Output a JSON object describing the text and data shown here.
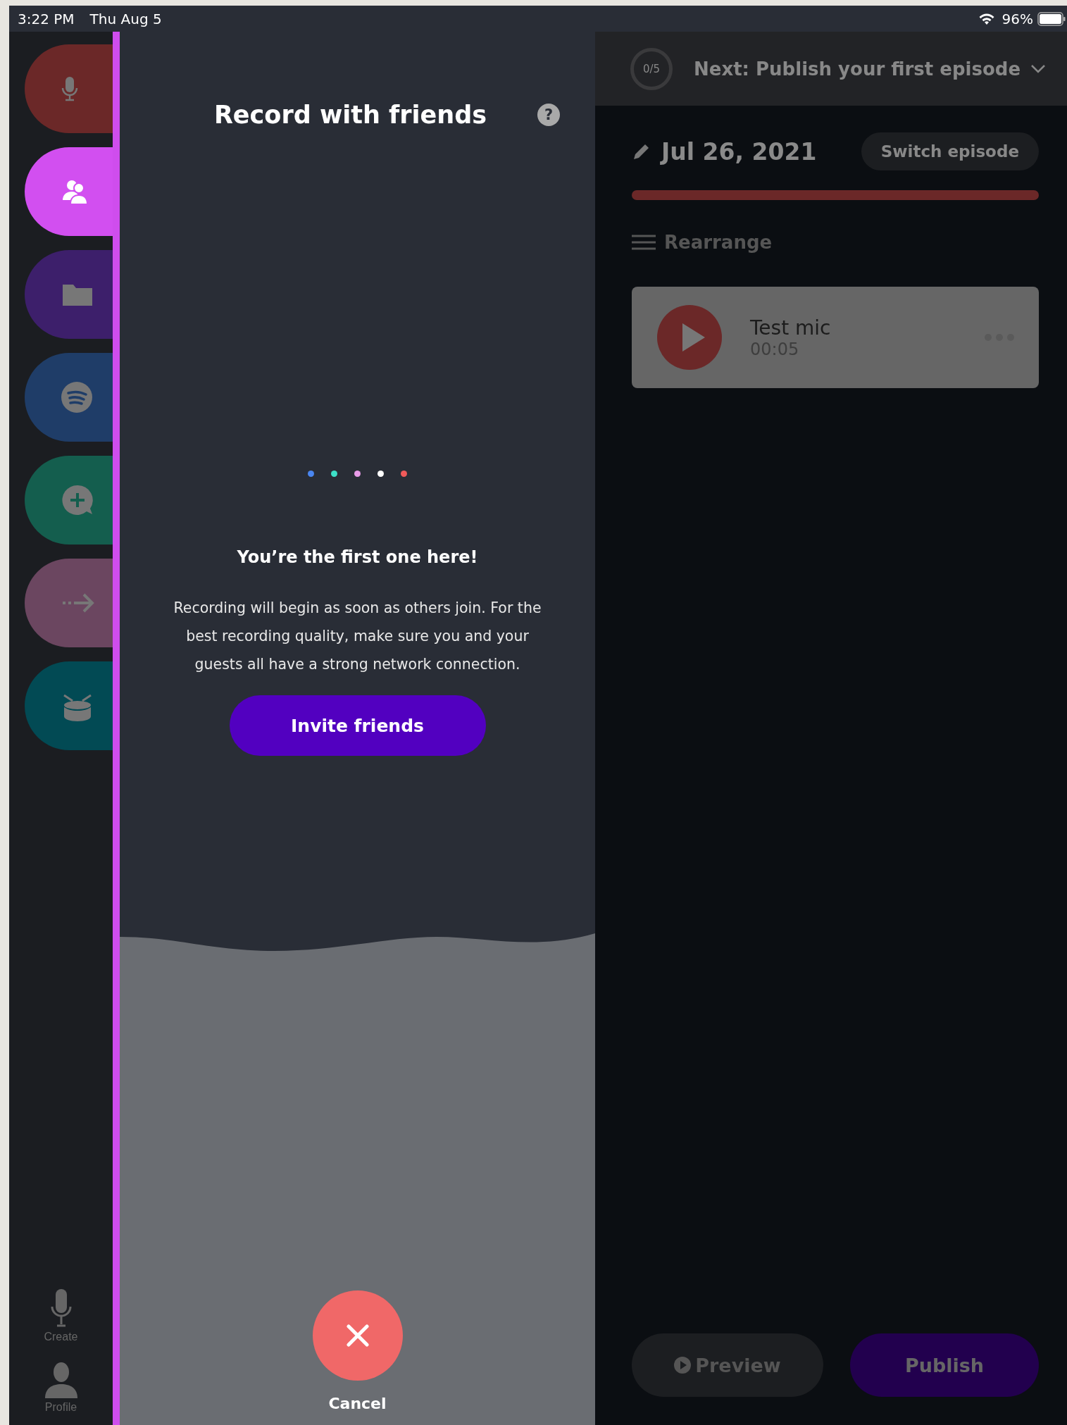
{
  "status_bar": {
    "time": "3:22 PM",
    "date": "Thu Aug 5",
    "battery": "96%"
  },
  "rail": {
    "tabs": [
      {
        "kind": "mic",
        "color": "#6b2828",
        "selected": false
      },
      {
        "kind": "people",
        "color": "#d24ff0",
        "selected": true
      },
      {
        "kind": "folder",
        "color": "#3d1f6b",
        "selected": false
      },
      {
        "kind": "stream",
        "color": "#1f3d68",
        "selected": false
      },
      {
        "kind": "chat",
        "color": "#145e4e",
        "selected": false
      },
      {
        "kind": "arrow",
        "color": "#6b4660",
        "selected": false
      },
      {
        "kind": "drum",
        "color": "#024a54",
        "selected": false
      }
    ],
    "bottom": [
      {
        "kind": "mic",
        "label": "Create"
      },
      {
        "kind": "person",
        "label": "Profile"
      }
    ]
  },
  "panel": {
    "title": "Record with friends",
    "help": "?",
    "dots": [
      {
        "color": "#4a86f0"
      },
      {
        "color": "#3de0c8"
      },
      {
        "color": "#e89be8"
      },
      {
        "color": "#ffffff"
      },
      {
        "color": "#f05a5a"
      }
    ],
    "heading": "You’re the first one here!",
    "message": "Recording will begin as soon as others join. For the best recording quality, make sure you and your guests all have a strong network connection.",
    "invite_button": "Invite friends",
    "cancel": "Cancel"
  },
  "episode": {
    "next_count": "0/5",
    "next_label": "Next: Publish your first episode",
    "date": "Jul 26, 2021",
    "switch_button": "Switch episode",
    "rearrange": "Rearrange",
    "segments": [
      {
        "title": "Test mic",
        "duration": "00:05"
      }
    ],
    "preview_button": "Preview",
    "publish_button": "Publish"
  }
}
